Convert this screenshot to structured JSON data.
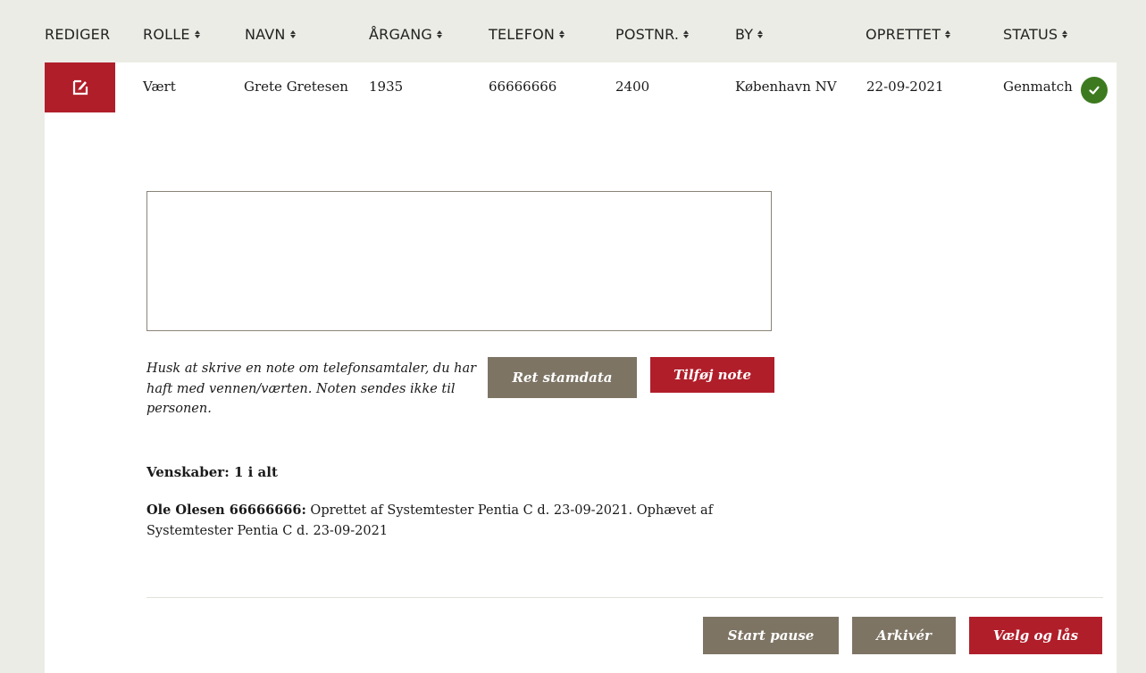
{
  "table": {
    "headers": [
      {
        "label": "REDIGER",
        "sortable": false
      },
      {
        "label": "ROLLE",
        "sortable": true
      },
      {
        "label": "NAVN",
        "sortable": true
      },
      {
        "label": "ÅRGANG",
        "sortable": true
      },
      {
        "label": "TELEFON",
        "sortable": true
      },
      {
        "label": "POSTNR.",
        "sortable": true
      },
      {
        "label": "BY",
        "sortable": true
      },
      {
        "label": "OPRETTET",
        "sortable": true
      },
      {
        "label": "STATUS",
        "sortable": true
      }
    ],
    "row": {
      "rolle": "Vært",
      "navn": "Grete Gretesen",
      "aargang": "1935",
      "telefon": "66666666",
      "postnr": "2400",
      "by": "København NV",
      "oprettet": "22-09-2021",
      "status": "Genmatch"
    }
  },
  "note": {
    "value": "",
    "hint": "Husk at skrive en note om telefonsamtaler, du har haft med vennen/værten. Noten sendes ikke til personen.",
    "edit_master_button": "Ret stamdata",
    "add_note_button": "Tilføj note"
  },
  "friendships": {
    "title": "Venskaber: 1 i alt",
    "items": [
      {
        "name_phone": "Ole Olesen 66666666:",
        "text": " Oprettet af Systemtester Pentia C d. 23-09-2021. Ophævet af Systemtester Pentia C d. 23-09-2021"
      }
    ]
  },
  "actions": {
    "start_pause": "Start pause",
    "archive": "Arkivér",
    "select_lock": "Vælg og lås"
  },
  "colors": {
    "accent_red": "#b01e2a",
    "button_grey": "#7d7464",
    "status_green": "#3d7a1f",
    "background": "#ecece6"
  },
  "icons": {
    "edit": "edit-icon",
    "status": "check-circle-icon",
    "sort": "sort-icon"
  }
}
